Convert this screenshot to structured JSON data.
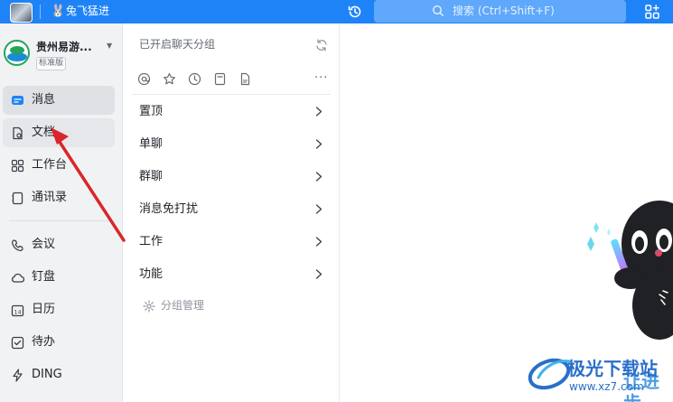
{
  "titlebar": {
    "title": "兔飞猛进",
    "search_placeholder": "搜索 (Ctrl+Shift+F)"
  },
  "org": {
    "name": "贵州易游...",
    "edition": "标准版"
  },
  "nav": {
    "items": [
      {
        "label": "消息",
        "icon": "message-icon"
      },
      {
        "label": "文档",
        "icon": "document-icon"
      },
      {
        "label": "工作台",
        "icon": "workbench-icon"
      },
      {
        "label": "通讯录",
        "icon": "contacts-icon"
      },
      {
        "label": "会议",
        "icon": "meeting-icon"
      },
      {
        "label": "钉盘",
        "icon": "cloud-drive-icon"
      },
      {
        "label": "日历",
        "icon": "calendar-icon"
      },
      {
        "label": "待办",
        "icon": "todo-icon"
      },
      {
        "label": "DING",
        "icon": "ding-icon"
      }
    ]
  },
  "mid": {
    "group_title": "已开启聊天分组",
    "categories": [
      {
        "label": "置顶"
      },
      {
        "label": "单聊"
      },
      {
        "label": "群聊"
      },
      {
        "label": "消息免打扰"
      },
      {
        "label": "工作"
      },
      {
        "label": "功能"
      }
    ],
    "manage_label": "分组管理"
  },
  "watermark": {
    "text": "极光下载站",
    "url": "www.xz7.com",
    "partial": "让进步"
  },
  "colors": {
    "titlebar": "#1e83f7",
    "search_bg": "#5fa8fb",
    "nav_bg": "#f1f2f4",
    "annotation": "#d9262b"
  }
}
